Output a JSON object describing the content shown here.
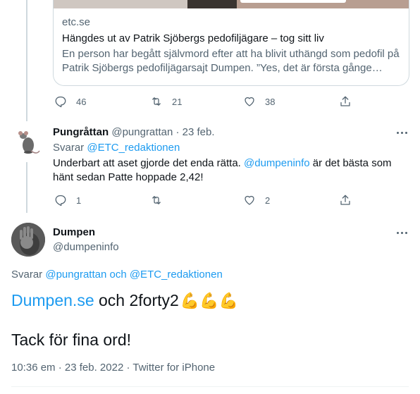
{
  "link_card": {
    "domain": "etc.se",
    "title": "Hängdes ut av Patrik Sjöbergs pedofiljägare – tog sitt liv",
    "description": "En person har begått självmord efter att ha blivit uthängd som pedofil på Patrik Sjöbergs pedofiljägarsajt Dumpen. ”Yes, det är första gånge…"
  },
  "first_actions": {
    "replies": "46",
    "retweets": "21",
    "likes": "38"
  },
  "reply_tweet": {
    "name": "Pungråttan",
    "handle": "@pungrattan",
    "sep": "·",
    "date": "23 feb.",
    "replying_prefix": "Svarar ",
    "replying_to": "@ETC_redaktionen",
    "text_1": "Underbart att aset gjorde det enda rätta. ",
    "mention": "@dumpeninfo",
    "text_2": " är det bästa som",
    "text_3": "hänt sedan Patte hoppade 2,42!",
    "actions": {
      "replies": "1",
      "retweets": "",
      "likes": "2"
    }
  },
  "main_tweet": {
    "name": "Dumpen",
    "handle": "@dumpeninfo",
    "replying_prefix": "Svarar ",
    "replying_to": "@pungrattan och @ETC_redaktionen",
    "link_text": "Dumpen.se",
    "text_1": " och 2forty2",
    "emojis": "💪💪💪",
    "text_2": "Tack för fina ord!",
    "time": "10:36 em",
    "sep1": "·",
    "date": "23 feb. 2022",
    "sep2": "·",
    "source": "Twitter for iPhone"
  },
  "icons": {
    "reply": "reply-icon",
    "retweet": "retweet-icon",
    "like": "heart-icon",
    "share": "share-icon",
    "more": "more-icon"
  },
  "colors": {
    "link": "#1d9bf0",
    "secondary_text": "#536471",
    "thread_line": "#cfd9de"
  }
}
